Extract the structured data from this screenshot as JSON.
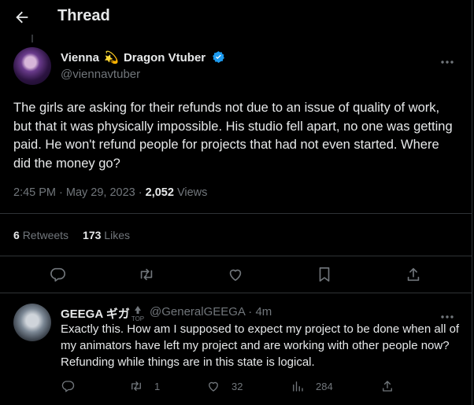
{
  "header": {
    "title": "Thread"
  },
  "tweet": {
    "author": {
      "name_pre": "Vienna",
      "name_emoji": "💫",
      "name_post": "Dragon Vtuber",
      "handle": "@viennavtuber"
    },
    "text": "The girls are asking for their refunds not due to an issue of quality of work, but that it was physically impossible. His studio fell apart, no one was getting paid. He won't refund people for projects that had not even started. Where did the money go?",
    "time": "2:45 PM · May 29, 2023 ·",
    "views_count": "2,052",
    "views_label": "Views",
    "retweets_count": "6",
    "retweets_label": "Retweets",
    "likes_count": "173",
    "likes_label": "Likes"
  },
  "reply": {
    "author": {
      "name": "GEEGA ギガ",
      "badge_label": "TOP",
      "handle": "@GeneralGEEGA · 4m"
    },
    "text": "Exactly this. How am I supposed to expect my project to be done when all of my animators have left my project and are working with other people now? Refunding while things are in this state is logical.",
    "retweets": "1",
    "likes": "32",
    "views": "284"
  },
  "colors": {
    "background": "#000000",
    "text": "#e7e9ea",
    "muted": "#71767b",
    "border": "#2f3336",
    "verified": "#1d9bf0"
  }
}
